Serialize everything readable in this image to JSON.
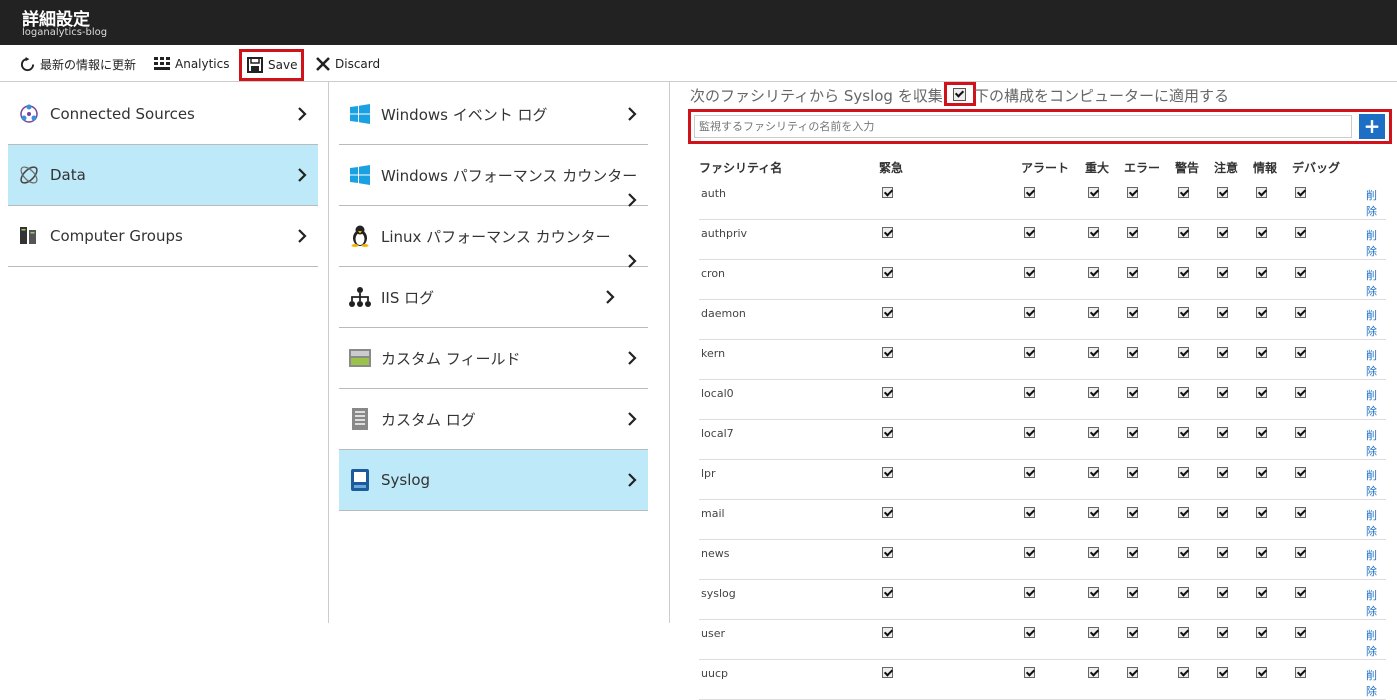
{
  "window": {
    "title": "詳細設定",
    "subtitle": "loganalytics-blog"
  },
  "toolbar": {
    "refresh_label": "最新の情報に更新",
    "analytics_label": "Analytics",
    "save_label": "Save",
    "discard_label": "Discard"
  },
  "sources_nav": [
    {
      "label": "Connected Sources",
      "icon": "connected-sources-icon",
      "selected": false
    },
    {
      "label": "Data",
      "icon": "data-icon",
      "selected": true
    },
    {
      "label": "Computer Groups",
      "icon": "computer-groups-icon",
      "selected": false
    }
  ],
  "data_nav": [
    {
      "label": "Windows イベント ログ",
      "icon": "windows-icon",
      "selected": false
    },
    {
      "label": "Windows パフォーマンス カウンター",
      "icon": "windows-icon",
      "selected": false
    },
    {
      "label": "Linux パフォーマンス カウンター",
      "icon": "linux-icon",
      "selected": false
    },
    {
      "label": "IIS ログ",
      "icon": "iis-icon",
      "selected": false
    },
    {
      "label": "カスタム フィールド",
      "icon": "custom-field-icon",
      "selected": false
    },
    {
      "label": "カスタム ログ",
      "icon": "custom-log-icon",
      "selected": false
    },
    {
      "label": "Syslog",
      "icon": "syslog-icon",
      "selected": true
    }
  ],
  "syslog": {
    "collect_label": "次のファシリティから Syslog を収集",
    "apply_label": "下の構成をコンピューターに適用する",
    "apply_checked": true,
    "add_placeholder": "監視するファシリティの名前を入力",
    "add_button": "+",
    "columns": [
      "ファシリティ名",
      "緊急",
      "アラート",
      "重大",
      "エラー",
      "警告",
      "注意",
      "情報",
      "デバッグ"
    ],
    "delete_label": "削除",
    "facilities": [
      "auth",
      "authpriv",
      "cron",
      "daemon",
      "kern",
      "local0",
      "local7",
      "lpr",
      "mail",
      "news",
      "syslog",
      "user",
      "uucp"
    ]
  },
  "colors": {
    "accent": "#1c6fc4",
    "selected_bg": "#bde9f8",
    "highlight": "#d0121b",
    "titlebar": "#222222"
  }
}
